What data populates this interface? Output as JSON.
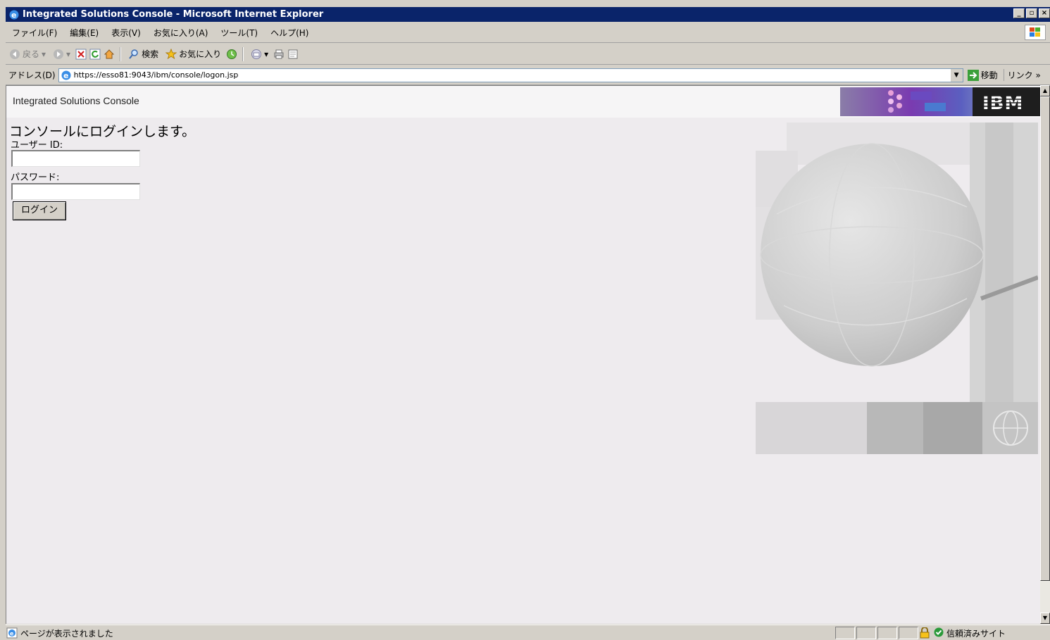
{
  "window": {
    "title": "Integrated Solutions Console - Microsoft Internet Explorer",
    "controls": {
      "minimize": "_",
      "maximize": "▫",
      "close": "×"
    }
  },
  "menubar": {
    "items": [
      {
        "label": "ファイル(F)"
      },
      {
        "label": "編集(E)"
      },
      {
        "label": "表示(V)"
      },
      {
        "label": "お気に入り(A)"
      },
      {
        "label": "ツール(T)"
      },
      {
        "label": "ヘルプ(H)"
      }
    ]
  },
  "toolbar": {
    "back_label": "戻る",
    "search_label": "検索",
    "favorites_label": "お気に入り",
    "icons": [
      "back-icon",
      "forward-icon",
      "stop-icon",
      "refresh-icon",
      "home-icon",
      "search-icon",
      "favorites-icon",
      "history-icon",
      "mail-icon",
      "print-icon",
      "edit-icon"
    ]
  },
  "addressbar": {
    "label": "アドレス(D)",
    "url": "https://esso81:9043/ibm/console/logon.jsp",
    "go_label": "移動",
    "links_label": "リンク »"
  },
  "page": {
    "banner_title": "Integrated Solutions Console",
    "brand": "IBM",
    "heading": "コンソールにログインします。",
    "user_id_label": "ユーザー ID:",
    "user_id_value": "",
    "password_label": "パスワード:",
    "password_value": "",
    "login_button": "ログイン"
  },
  "statusbar": {
    "message": "ページが表示されました",
    "zone": "信頼済みサイト"
  },
  "colors": {
    "titlebar": "#0a246a",
    "chrome": "#d4d0c8",
    "content_bg": "#eeebee"
  }
}
